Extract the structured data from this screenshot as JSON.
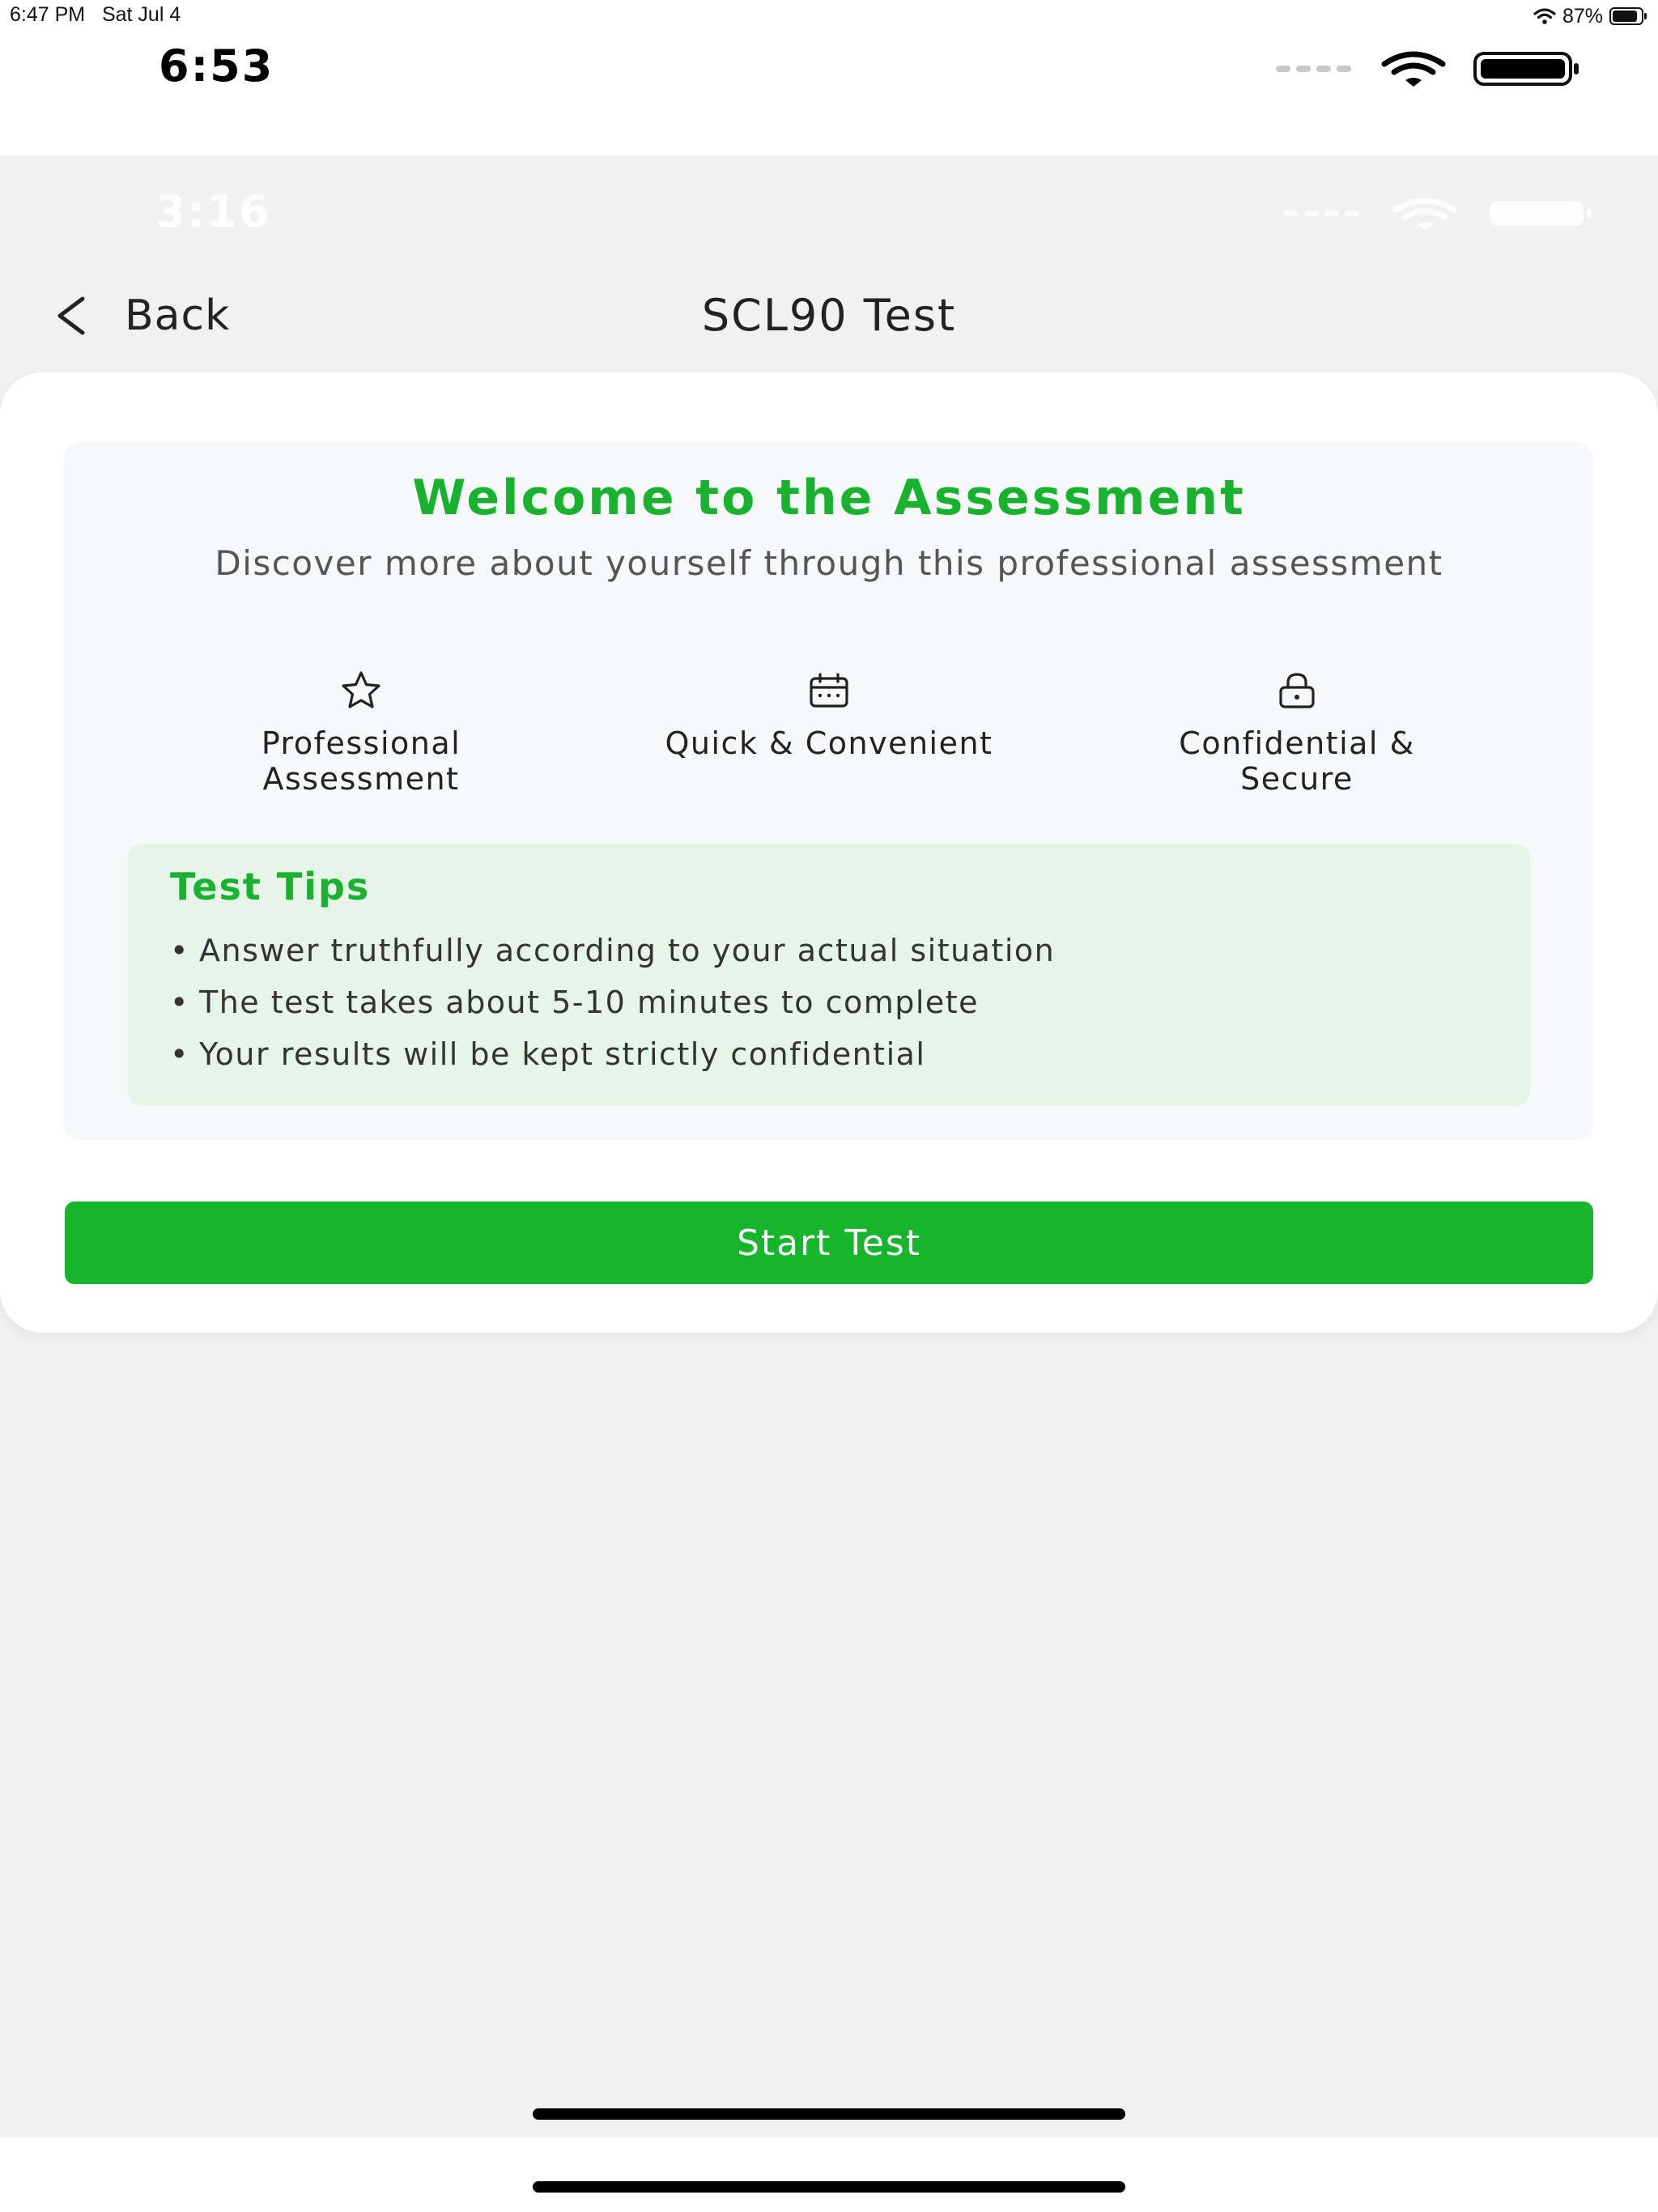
{
  "ipad_status": {
    "time": "6:47 PM",
    "date": "Sat Jul 4",
    "battery_percent": "87%",
    "battery_level": 0.87
  },
  "phone_status": {
    "time": "6:53",
    "faded_time": "3:16"
  },
  "nav": {
    "back_label": "Back",
    "title": "SCL90 Test"
  },
  "welcome": {
    "title": "Welcome to the Assessment",
    "subtitle": "Discover more about yourself through this professional assessment"
  },
  "features": [
    {
      "icon": "star-icon",
      "label": "Professional Assessment"
    },
    {
      "icon": "calendar-icon",
      "label": "Quick & Convenient"
    },
    {
      "icon": "lock-icon",
      "label": "Confidential & Secure"
    }
  ],
  "tips": {
    "title": "Test Tips",
    "items": [
      "Answer truthfully according to your actual situation",
      "The test takes about 5-10 minutes to complete",
      "Your results will be kept strictly confidential"
    ]
  },
  "actions": {
    "start_label": "Start Test"
  },
  "colors": {
    "accent": "#19b22e",
    "button": "#15b52c",
    "tips_bg": "#e7f4e8",
    "panel_bg": "#f7f8fa",
    "page_bg": "#f1f1f1"
  }
}
